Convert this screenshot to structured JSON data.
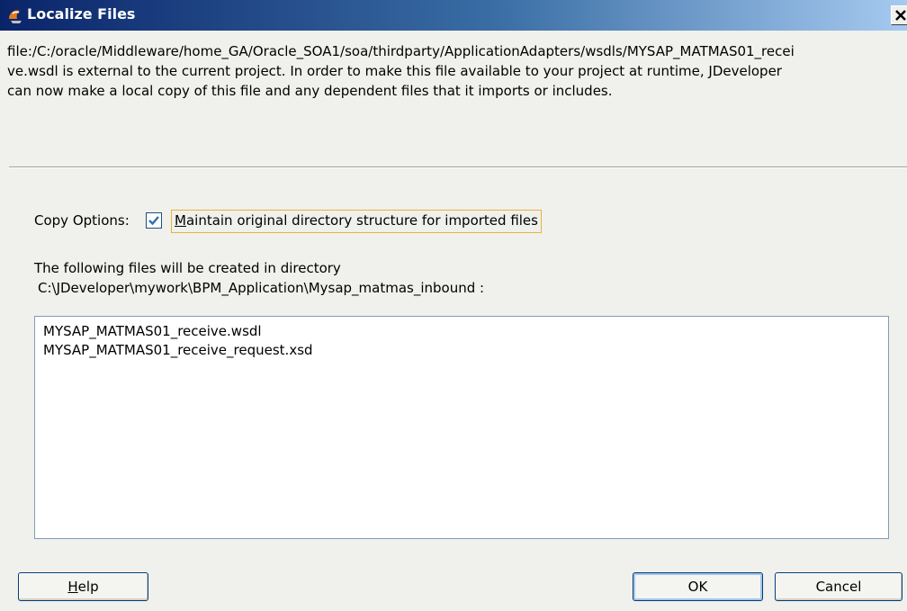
{
  "window": {
    "title": "Localize Files",
    "close_icon": "close-icon"
  },
  "message": {
    "line1": "file:/C:/oracle/Middleware/home_GA/Oracle_SOA1/soa/thirdparty/ApplicationAdapters/wsdls/MYSAP_MATMAS01_recei",
    "line2": "ve.wsdl is external to the current project. In order to make this file available to your project at runtime, JDeveloper",
    "line3": "can now make a local copy of this file and any dependent files that it imports or includes."
  },
  "copy_options": {
    "label": "Copy Options:",
    "checkbox_checked": true,
    "checkbox_label_mnemonic": "M",
    "checkbox_label_rest": "aintain original directory structure for imported files"
  },
  "directory": {
    "intro": "The following files will be created in directory",
    "path": "C:\\JDeveloper\\mywork\\BPM_Application\\Mysap_matmas_inbound :"
  },
  "files": [
    "MYSAP_MATMAS01_receive.wsdl",
    "MYSAP_MATMAS01_receive_request.xsd"
  ],
  "buttons": {
    "help_mnemonic": "H",
    "help_rest": "elp",
    "ok": "OK",
    "cancel": "Cancel"
  },
  "colors": {
    "titlebar_start": "#0a246a",
    "titlebar_end": "#a6caf0",
    "dialog_bg": "#f0f0ec",
    "focus_border": "#e8b33a",
    "checkbox_check": "#2f6fb5"
  }
}
